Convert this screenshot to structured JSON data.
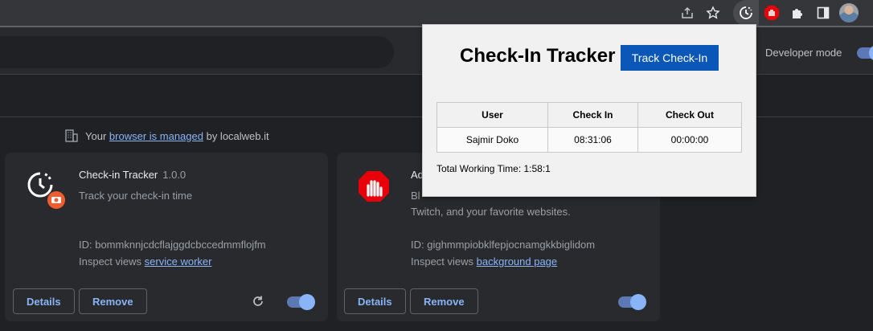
{
  "toolbar": {
    "icons": [
      "share-icon",
      "star-icon",
      "check-in-tracker-extension-icon",
      "adblock-extension-icon",
      "extensions-puzzle-icon",
      "side-panel-icon",
      "profile-avatar"
    ]
  },
  "header": {
    "developer_mode_label": "Developer mode",
    "developer_mode_on": true
  },
  "managed_notice": {
    "prefix": "Your",
    "link": "browser is managed",
    "suffix": "by localweb.it"
  },
  "extensions": [
    {
      "name": "Check-in Tracker",
      "version": "1.0.0",
      "description": "Track your check-in time",
      "id_text": "ID: bommknnjcdcflajggdcbccedmmflojfm",
      "inspect_prefix": "Inspect views",
      "inspect_link": "service worker",
      "details_label": "Details",
      "remove_label": "Remove",
      "enabled": true
    },
    {
      "name": "Ad",
      "description_line1": "Bl",
      "description_line2": "Twitch, and your favorite websites.",
      "id_text": "ID: gighmmpiobklfepjocnamgkkbiglidom",
      "inspect_prefix": "Inspect views",
      "inspect_link": "background page",
      "details_label": "Details",
      "remove_label": "Remove",
      "enabled": true
    }
  ],
  "popup": {
    "title": "Check-In Tracker",
    "track_button": "Track Check-In",
    "columns": [
      "User",
      "Check In",
      "Check Out"
    ],
    "rows": [
      [
        "Sajmir Doko",
        "08:31:06",
        "00:00:00"
      ]
    ],
    "total_working_time": "Total Working Time: 1:58:1"
  },
  "colors": {
    "page_bg": "#202124",
    "card_bg": "#292a2d",
    "accent": "#8ab4f8",
    "popup_button": "#0b57b8"
  }
}
